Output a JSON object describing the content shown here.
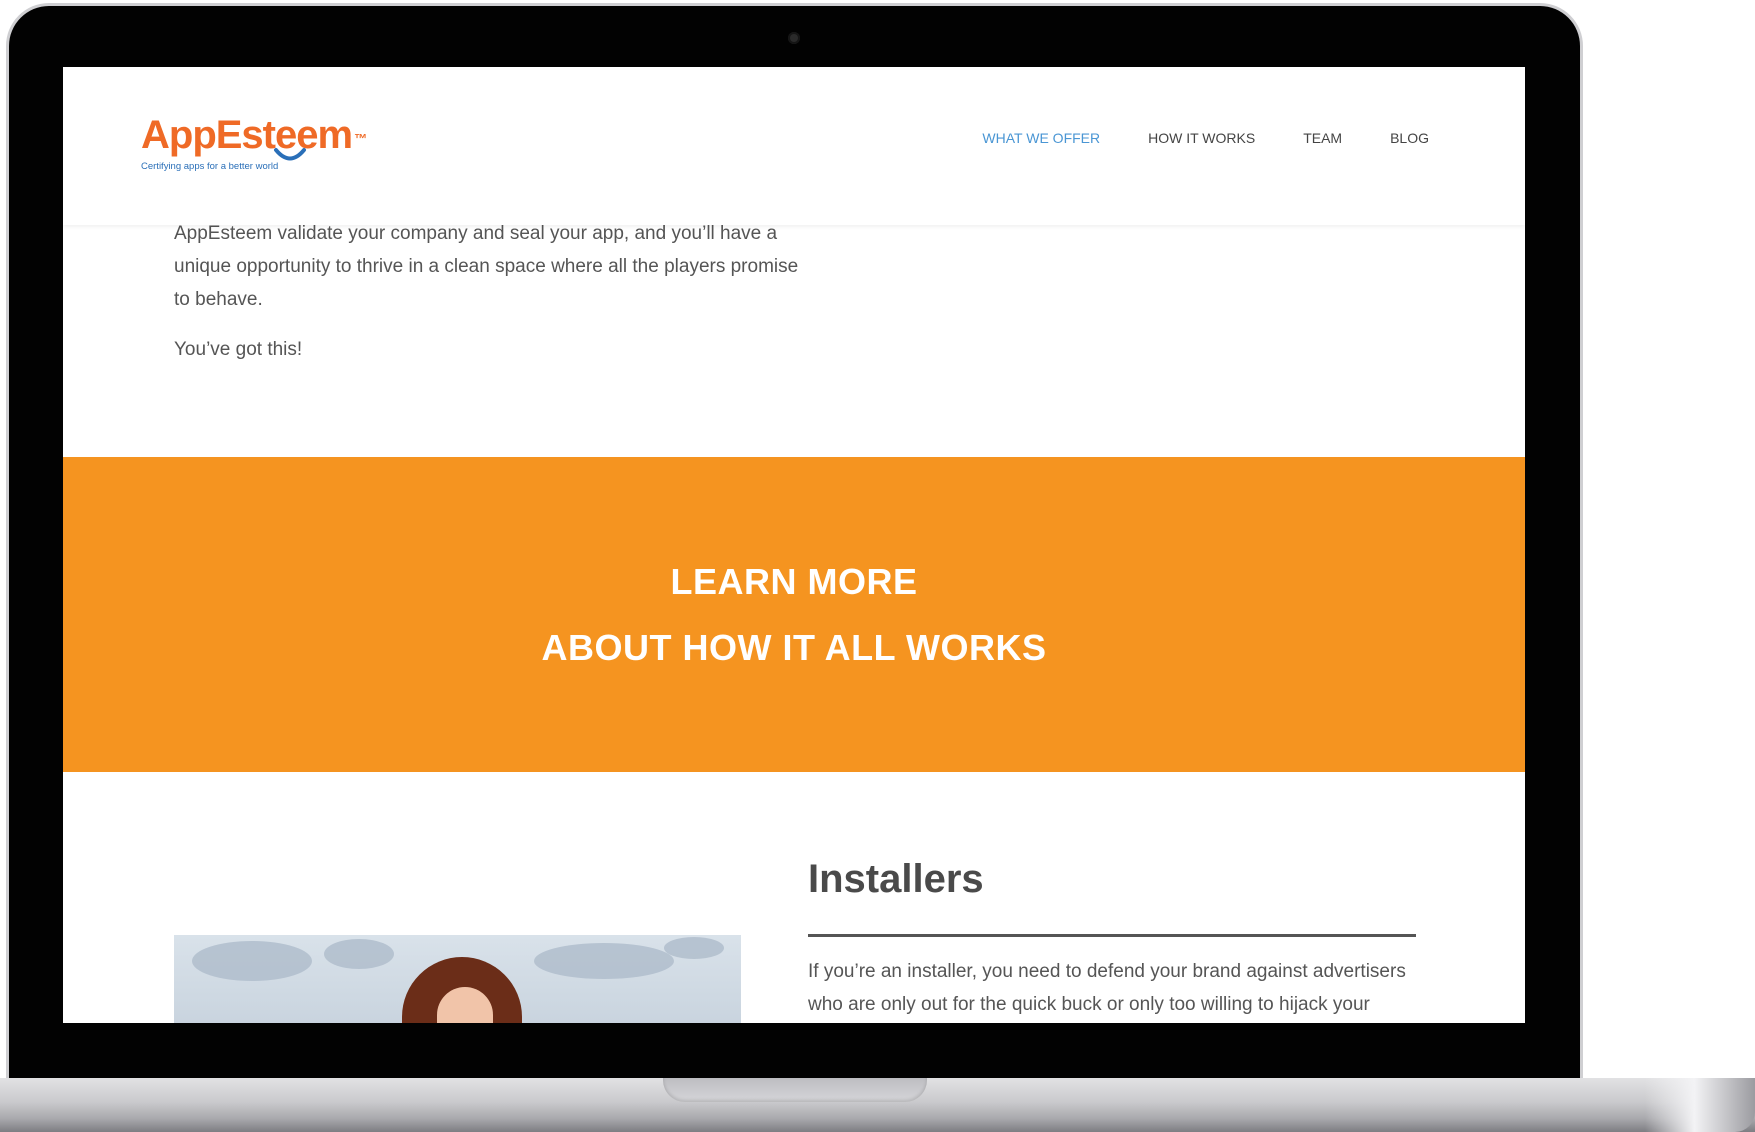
{
  "logo": {
    "name": "AppEsteem",
    "trademark": "™",
    "tagline": "Certifying apps for a better world"
  },
  "nav": {
    "items": [
      {
        "label": "WHAT WE OFFER",
        "active": true
      },
      {
        "label": "HOW IT WORKS",
        "active": false
      },
      {
        "label": "TEAM",
        "active": false
      },
      {
        "label": "BLOG",
        "active": false
      }
    ]
  },
  "intro": {
    "paragraph": "AppEsteem validate your company and seal your app, and you’ll have a unique opportunity to thrive in a clean space where all the players promise to behave.",
    "closing": "You’ve got this!"
  },
  "cta": {
    "line1": "LEARN MORE",
    "line2": "ABOUT HOW IT ALL WORKS"
  },
  "installers": {
    "title": "Installers",
    "text": "If you’re an installer, you need to defend your brand against advertisers who are only out for the quick buck or only too willing to hijack your"
  },
  "colors": {
    "brand_orange": "#ef6a26",
    "cta_background": "#f59420",
    "nav_active": "#4a96d4",
    "tagline_blue": "#2a6fb8"
  }
}
